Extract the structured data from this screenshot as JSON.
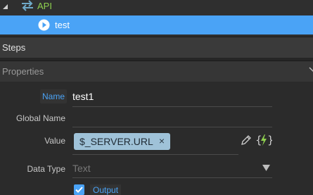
{
  "tree": {
    "api_label": "API",
    "test_label": "test"
  },
  "sections": {
    "steps": "Steps",
    "properties": "Properties"
  },
  "properties": {
    "name_label": "Name",
    "name_value": "test1",
    "global_name_label": "Global Name",
    "value_label": "Value",
    "value_chip": "$_SERVER.URL",
    "chip_remove": "×",
    "data_type_label": "Data Type",
    "data_type_value": "Text",
    "output_label": "Output"
  },
  "colors": {
    "accent": "#4aa3f6",
    "api_green": "#8fd14f",
    "bolt_green": "#8fd14f",
    "chip": "#9fc2d8"
  },
  "icons": {
    "expand": "triangle-expanded-icon",
    "api": "swap-arrows-icon",
    "test": "play-circle-icon",
    "edit": "pencil-icon",
    "dynamic": "bolt-braces-icon",
    "dropdown": "caret-down-icon",
    "collapse": "chevron-down-icon",
    "output": "checkbox-checked-icon"
  }
}
